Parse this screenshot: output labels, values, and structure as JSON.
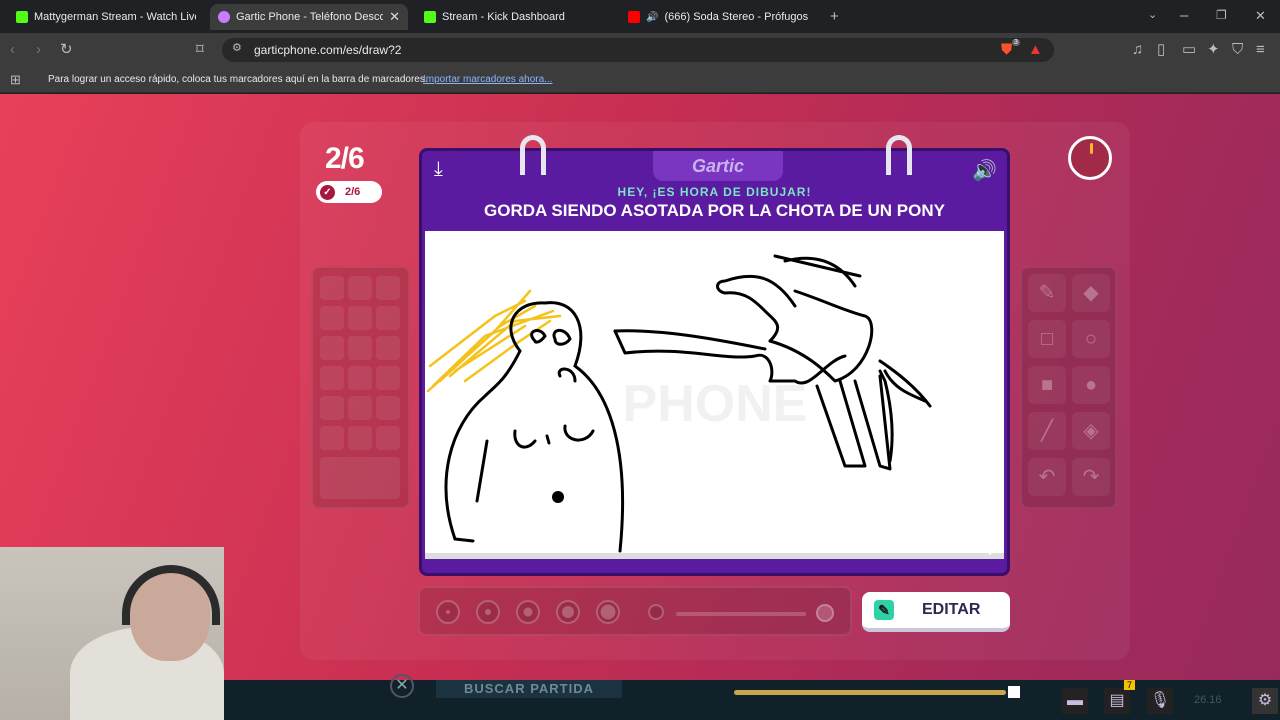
{
  "browser": {
    "tabs": [
      {
        "title": "Mattygerman Stream - Watch Live on",
        "fav": "#53fc18"
      },
      {
        "title": "Gartic Phone - Teléfono Descomp",
        "fav": "#c77dff",
        "close": "✕"
      },
      {
        "title": "Stream - Kick Dashboard",
        "fav": "#53fc18"
      },
      {
        "title": "(666) Soda Stereo - Prófugos (Let",
        "fav": "#ff0000"
      }
    ],
    "url": "garticphone.com/es/draw?2",
    "bookmarks_text": "Para lograr un acceso rápido, coloca tus marcadores aquí en la barra de marcadores.",
    "bookmarks_link": "Importar marcadores ahora...",
    "brave_badge": "3"
  },
  "game": {
    "round": "2/6",
    "progress": "2/6",
    "logo": "Gartic",
    "prompt_label": "HEY, ¡ES HORA DE DIBUJAR!",
    "phrase": "GORDA SIENDO ASOTADA POR LA CHOTA DE UN PONY",
    "edit_button": "EDITAR",
    "canvas_watermark": "PHONE"
  },
  "taskbar": {
    "search_button": "BUSCAR PARTIDA",
    "badge": "7",
    "clock": "26.16"
  },
  "colors": {
    "accent": "#5b1ba0",
    "background": "#c62e52",
    "hey": "#7de3c8"
  }
}
